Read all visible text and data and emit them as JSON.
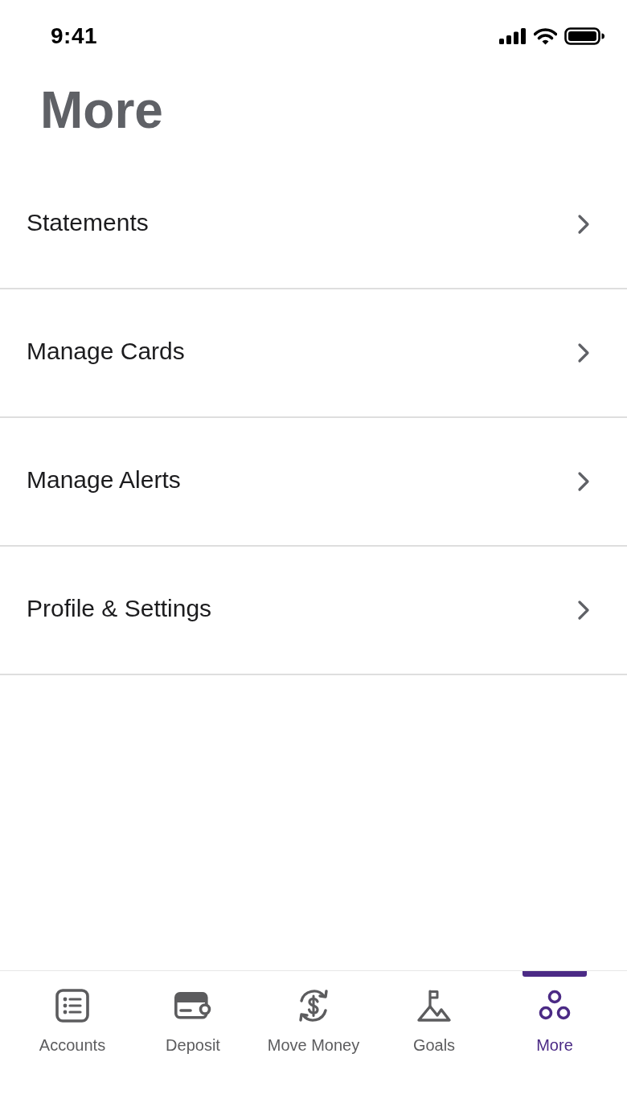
{
  "status_bar": {
    "time": "9:41"
  },
  "header": {
    "title": "More"
  },
  "menu": {
    "items": [
      {
        "label": "Statements"
      },
      {
        "label": "Manage Cards"
      },
      {
        "label": "Manage Alerts"
      },
      {
        "label": "Profile & Settings"
      }
    ]
  },
  "tab_bar": {
    "tabs": [
      {
        "label": "Accounts",
        "selected": false
      },
      {
        "label": "Deposit",
        "selected": false
      },
      {
        "label": "Move Money",
        "selected": false
      },
      {
        "label": "Goals",
        "selected": false
      },
      {
        "label": "More",
        "selected": true
      }
    ]
  }
}
